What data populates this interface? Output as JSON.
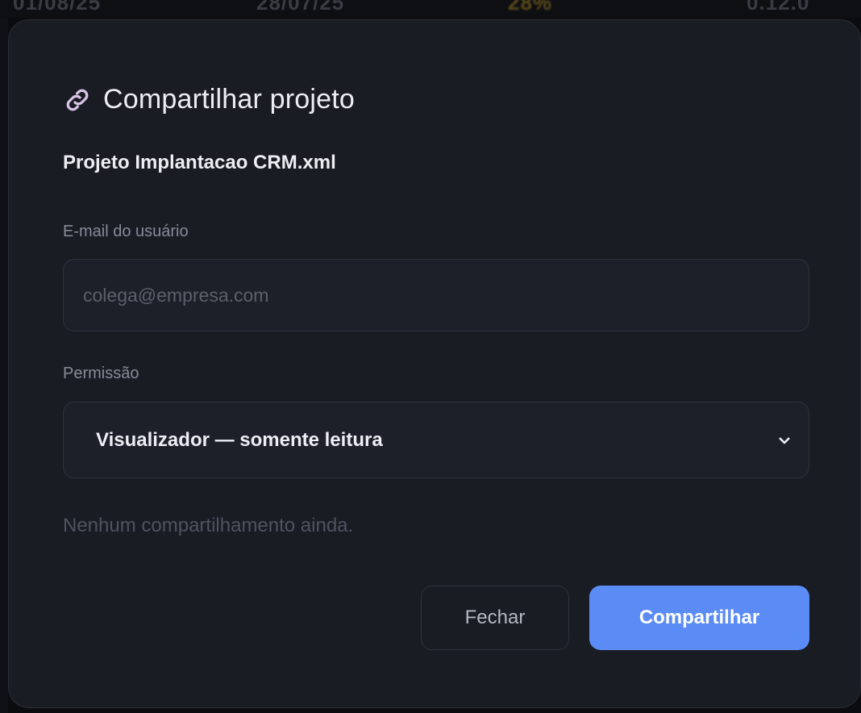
{
  "background": {
    "columns": [
      "01/08/25",
      "28/07/25",
      "28%",
      "0.12.0"
    ]
  },
  "dialog": {
    "icon": "link-icon",
    "title": "Compartilhar projeto",
    "filename": "Projeto Implantacao CRM.xml",
    "email": {
      "label": "E-mail do usuário",
      "placeholder": "colega@empresa.com",
      "value": ""
    },
    "permission": {
      "label": "Permissão",
      "selected": "Visualizador — somente leitura"
    },
    "empty_message": "Nenhum compartilhamento ainda.",
    "buttons": {
      "close": "Fechar",
      "share": "Compartilhar"
    }
  },
  "colors": {
    "accent": "#5b8cf5",
    "dialog_bg": "#1a1c23",
    "icon": "#d9c3e6"
  }
}
